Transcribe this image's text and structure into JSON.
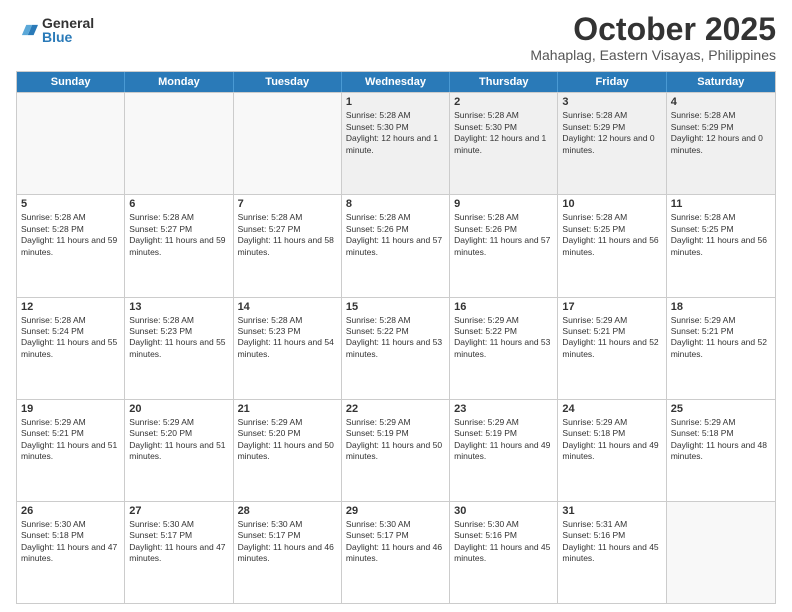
{
  "header": {
    "logo": {
      "general": "General",
      "blue": "Blue"
    },
    "title": "October 2025",
    "subtitle": "Mahaplag, Eastern Visayas, Philippines"
  },
  "calendar": {
    "weekdays": [
      "Sunday",
      "Monday",
      "Tuesday",
      "Wednesday",
      "Thursday",
      "Friday",
      "Saturday"
    ],
    "rows": [
      [
        {
          "day": "",
          "empty": true
        },
        {
          "day": "",
          "empty": true
        },
        {
          "day": "",
          "empty": true
        },
        {
          "day": "1",
          "sunrise": "5:28 AM",
          "sunset": "5:30 PM",
          "daylight": "12 hours and 1 minute."
        },
        {
          "day": "2",
          "sunrise": "5:28 AM",
          "sunset": "5:30 PM",
          "daylight": "12 hours and 1 minute."
        },
        {
          "day": "3",
          "sunrise": "5:28 AM",
          "sunset": "5:29 PM",
          "daylight": "12 hours and 0 minutes."
        },
        {
          "day": "4",
          "sunrise": "5:28 AM",
          "sunset": "5:29 PM",
          "daylight": "12 hours and 0 minutes."
        }
      ],
      [
        {
          "day": "5",
          "sunrise": "5:28 AM",
          "sunset": "5:28 PM",
          "daylight": "11 hours and 59 minutes."
        },
        {
          "day": "6",
          "sunrise": "5:28 AM",
          "sunset": "5:27 PM",
          "daylight": "11 hours and 59 minutes."
        },
        {
          "day": "7",
          "sunrise": "5:28 AM",
          "sunset": "5:27 PM",
          "daylight": "11 hours and 58 minutes."
        },
        {
          "day": "8",
          "sunrise": "5:28 AM",
          "sunset": "5:26 PM",
          "daylight": "11 hours and 57 minutes."
        },
        {
          "day": "9",
          "sunrise": "5:28 AM",
          "sunset": "5:26 PM",
          "daylight": "11 hours and 57 minutes."
        },
        {
          "day": "10",
          "sunrise": "5:28 AM",
          "sunset": "5:25 PM",
          "daylight": "11 hours and 56 minutes."
        },
        {
          "day": "11",
          "sunrise": "5:28 AM",
          "sunset": "5:25 PM",
          "daylight": "11 hours and 56 minutes."
        }
      ],
      [
        {
          "day": "12",
          "sunrise": "5:28 AM",
          "sunset": "5:24 PM",
          "daylight": "11 hours and 55 minutes."
        },
        {
          "day": "13",
          "sunrise": "5:28 AM",
          "sunset": "5:23 PM",
          "daylight": "11 hours and 55 minutes."
        },
        {
          "day": "14",
          "sunrise": "5:28 AM",
          "sunset": "5:23 PM",
          "daylight": "11 hours and 54 minutes."
        },
        {
          "day": "15",
          "sunrise": "5:28 AM",
          "sunset": "5:22 PM",
          "daylight": "11 hours and 53 minutes."
        },
        {
          "day": "16",
          "sunrise": "5:29 AM",
          "sunset": "5:22 PM",
          "daylight": "11 hours and 53 minutes."
        },
        {
          "day": "17",
          "sunrise": "5:29 AM",
          "sunset": "5:21 PM",
          "daylight": "11 hours and 52 minutes."
        },
        {
          "day": "18",
          "sunrise": "5:29 AM",
          "sunset": "5:21 PM",
          "daylight": "11 hours and 52 minutes."
        }
      ],
      [
        {
          "day": "19",
          "sunrise": "5:29 AM",
          "sunset": "5:21 PM",
          "daylight": "11 hours and 51 minutes."
        },
        {
          "day": "20",
          "sunrise": "5:29 AM",
          "sunset": "5:20 PM",
          "daylight": "11 hours and 51 minutes."
        },
        {
          "day": "21",
          "sunrise": "5:29 AM",
          "sunset": "5:20 PM",
          "daylight": "11 hours and 50 minutes."
        },
        {
          "day": "22",
          "sunrise": "5:29 AM",
          "sunset": "5:19 PM",
          "daylight": "11 hours and 50 minutes."
        },
        {
          "day": "23",
          "sunrise": "5:29 AM",
          "sunset": "5:19 PM",
          "daylight": "11 hours and 49 minutes."
        },
        {
          "day": "24",
          "sunrise": "5:29 AM",
          "sunset": "5:18 PM",
          "daylight": "11 hours and 49 minutes."
        },
        {
          "day": "25",
          "sunrise": "5:29 AM",
          "sunset": "5:18 PM",
          "daylight": "11 hours and 48 minutes."
        }
      ],
      [
        {
          "day": "26",
          "sunrise": "5:30 AM",
          "sunset": "5:18 PM",
          "daylight": "11 hours and 47 minutes."
        },
        {
          "day": "27",
          "sunrise": "5:30 AM",
          "sunset": "5:17 PM",
          "daylight": "11 hours and 47 minutes."
        },
        {
          "day": "28",
          "sunrise": "5:30 AM",
          "sunset": "5:17 PM",
          "daylight": "11 hours and 46 minutes."
        },
        {
          "day": "29",
          "sunrise": "5:30 AM",
          "sunset": "5:17 PM",
          "daylight": "11 hours and 46 minutes."
        },
        {
          "day": "30",
          "sunrise": "5:30 AM",
          "sunset": "5:16 PM",
          "daylight": "11 hours and 45 minutes."
        },
        {
          "day": "31",
          "sunrise": "5:31 AM",
          "sunset": "5:16 PM",
          "daylight": "11 hours and 45 minutes."
        },
        {
          "day": "",
          "empty": true
        }
      ]
    ]
  }
}
